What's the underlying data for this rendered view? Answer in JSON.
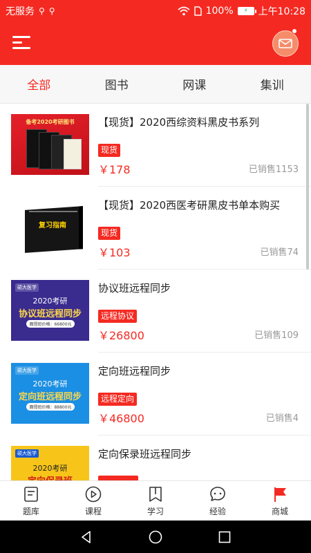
{
  "status_bar": {
    "carrier": "无服务",
    "battery": "100%",
    "time": "上午10:28"
  },
  "tabs": [
    {
      "label": "全部",
      "active": true
    },
    {
      "label": "图书",
      "active": false
    },
    {
      "label": "网课",
      "active": false
    },
    {
      "label": "集训",
      "active": false
    }
  ],
  "products": [
    {
      "title": "【现货】2020西综资料黑皮书系列",
      "tag": "现货",
      "price": "￥178",
      "sold": "已销售1153",
      "thumb": {
        "banner": "备考2020考研图书"
      }
    },
    {
      "title": "【现货】2020西医考研黑皮书单本购买",
      "tag": "现货",
      "price": "￥103",
      "sold": "已销售74",
      "thumb": {
        "cover": "复习指南"
      }
    },
    {
      "title": "协议班远程同步",
      "tag": "远程协议",
      "price": "￥26800",
      "sold": "已销售109",
      "thumb": {
        "logo": "硕大医学",
        "line1": "2020考研",
        "line2": "协议班远程同步",
        "line3": "面授班价格：66800元"
      }
    },
    {
      "title": "定向班远程同步",
      "tag": "远程定向",
      "price": "￥46800",
      "sold": "已销售4",
      "thumb": {
        "logo": "硕大医学",
        "line1": "2020考研",
        "line2": "定向班远程同步",
        "line3": "面授班价格：88800元"
      }
    },
    {
      "title": "定向保录班远程同步",
      "tag": "",
      "price": "",
      "sold": "",
      "thumb": {
        "logo": "硕大医学",
        "line1": "2020考研",
        "line2": "定向保录班",
        "line3": ""
      }
    }
  ],
  "bottom_nav": [
    {
      "label": "题库",
      "icon": "question-bank-icon"
    },
    {
      "label": "课程",
      "icon": "play-circle-icon"
    },
    {
      "label": "学习",
      "icon": "bookmark-book-icon"
    },
    {
      "label": "经验",
      "icon": "chat-bubble-icon"
    },
    {
      "label": "商城",
      "icon": "red-flag-icon"
    }
  ],
  "colors": {
    "brand": "#f42a22",
    "muted": "#999999"
  }
}
